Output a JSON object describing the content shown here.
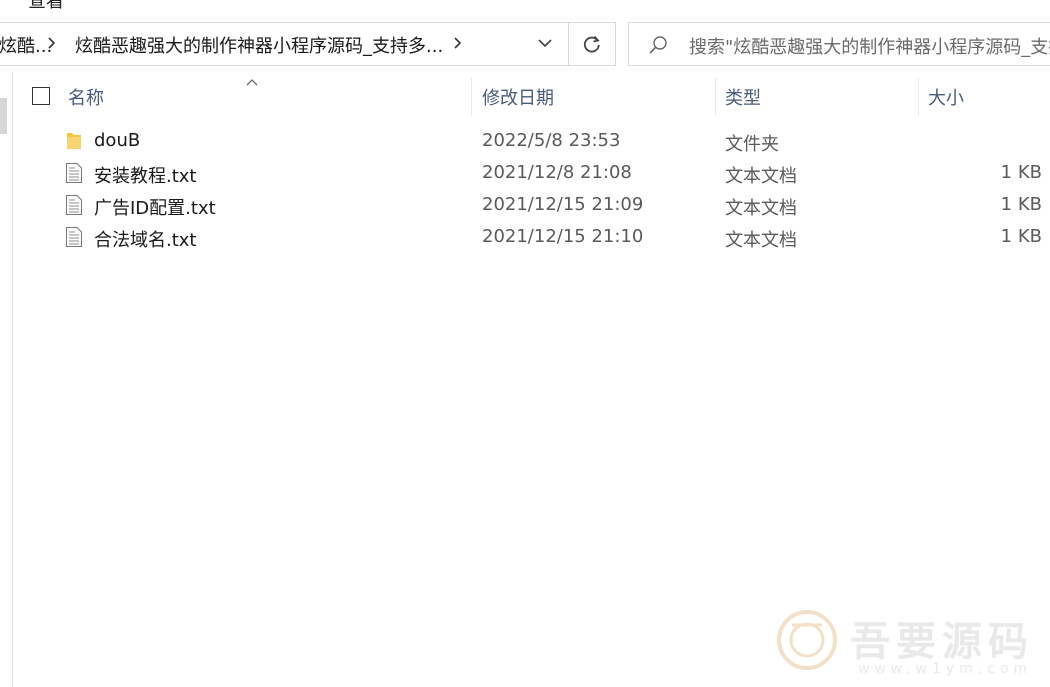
{
  "menu": {
    "view_label": "查看"
  },
  "address_bar": {
    "crumb_prev": "炫酷...",
    "crumb_current": "炫酷恶趣强大的制作神器小程序源码_支持多..."
  },
  "search": {
    "placeholder": "搜索\"炫酷恶趣强大的制作神器小程序源码_支持多...\""
  },
  "columns": {
    "name": "名称",
    "date": "修改日期",
    "type": "类型",
    "size": "大小"
  },
  "files": [
    {
      "name": "douB",
      "date": "2022/5/8 23:53",
      "type": "文件夹",
      "size": "",
      "icon": "folder-icon"
    },
    {
      "name": "安装教程.txt",
      "date": "2021/12/8 21:08",
      "type": "文本文档",
      "size": "1 KB",
      "icon": "text-file-icon"
    },
    {
      "name": "广告ID配置.txt",
      "date": "2021/12/15 21:09",
      "type": "文本文档",
      "size": "1 KB",
      "icon": "text-file-icon"
    },
    {
      "name": "合法域名.txt",
      "date": "2021/12/15 21:10",
      "type": "文本文档",
      "size": "1 KB",
      "icon": "text-file-icon"
    }
  ],
  "watermark": {
    "title": "吾要源码",
    "url": "www.w1ym.com"
  },
  "colors": {
    "header_text": "#4a5b7c",
    "folder": "#f4c542",
    "border": "#d9d9d9"
  }
}
